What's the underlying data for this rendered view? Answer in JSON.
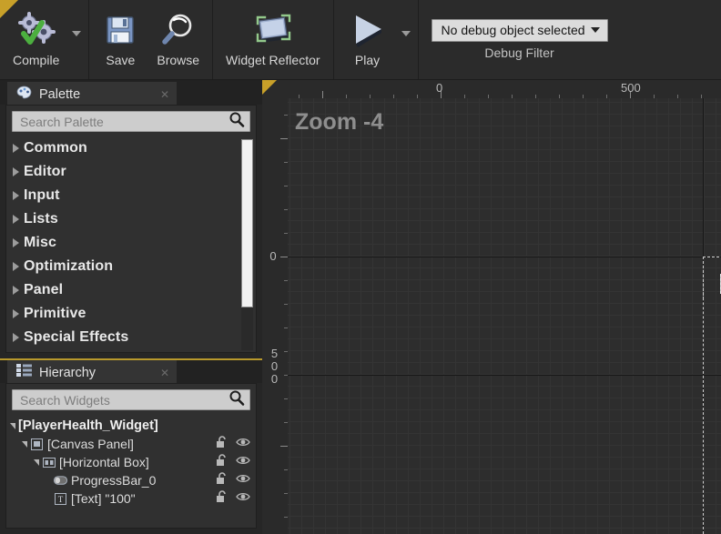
{
  "toolbar": {
    "compile": {
      "label": "Compile",
      "icon": "compile-gears-check-icon"
    },
    "save": {
      "label": "Save",
      "icon": "floppy-disk-icon"
    },
    "browse": {
      "label": "Browse",
      "icon": "magnifier-browse-icon"
    },
    "widget_reflector": {
      "label": "Widget Reflector",
      "icon": "widget-reflector-icon"
    },
    "play": {
      "label": "Play",
      "icon": "play-triangle-icon"
    },
    "debug_filter": {
      "value": "No debug object selected",
      "caption": "Debug Filter",
      "caret_icon": "chevron-down-icon"
    }
  },
  "palette": {
    "tab_title": "Palette",
    "tab_icon": "palette-icon",
    "close_icon": "close-icon",
    "search": {
      "placeholder": "Search Palette",
      "value": "",
      "icon": "search-icon"
    },
    "categories": [
      {
        "label": "Common"
      },
      {
        "label": "Editor"
      },
      {
        "label": "Input"
      },
      {
        "label": "Lists"
      },
      {
        "label": "Misc"
      },
      {
        "label": "Optimization"
      },
      {
        "label": "Panel"
      },
      {
        "label": "Primitive"
      },
      {
        "label": "Special Effects"
      }
    ]
  },
  "hierarchy": {
    "tab_title": "Hierarchy",
    "tab_icon": "hierarchy-list-icon",
    "close_icon": "close-icon",
    "search": {
      "placeholder": "Search Widgets",
      "value": "",
      "icon": "search-icon"
    },
    "tree": [
      {
        "label": "[PlayerHealth_Widget]",
        "icon": "none",
        "depth": 0,
        "expanded": true,
        "has_toggles": false
      },
      {
        "label": "[Canvas Panel]",
        "icon": "canvas-panel-icon",
        "depth": 1,
        "expanded": true,
        "has_toggles": true
      },
      {
        "label": "[Horizontal Box]",
        "icon": "horizontal-box-icon",
        "depth": 2,
        "expanded": true,
        "has_toggles": true
      },
      {
        "label": "ProgressBar_0",
        "icon": "progress-bar-icon",
        "depth": 3,
        "expanded": false,
        "has_toggles": true
      },
      {
        "label": "[Text] \"100\"",
        "icon": "text-widget-icon",
        "depth": 3,
        "expanded": false,
        "has_toggles": true
      }
    ],
    "lock_icon": "unlocked-padlock-icon",
    "visibility_icon": "eye-icon"
  },
  "designer": {
    "zoom_label": "Zoom -4",
    "ruler_h_labels": [
      {
        "text": "0",
        "pos": 484
      },
      {
        "text": "500",
        "pos": 692
      }
    ],
    "ruler_v_labels": [
      {
        "text": "0",
        "pos": 194
      },
      {
        "text": "500",
        "pos": 388
      }
    ],
    "text_widget_value": "100",
    "progressbar_name": "ProgressBar_0"
  },
  "colors": {
    "accent_gold": "#c8a029",
    "panel_bg": "#303030",
    "toolbar_bg": "#2b2b2b",
    "canvas_bg": "#2d2d2d",
    "progressbar_fill": "#c9c9c9"
  }
}
